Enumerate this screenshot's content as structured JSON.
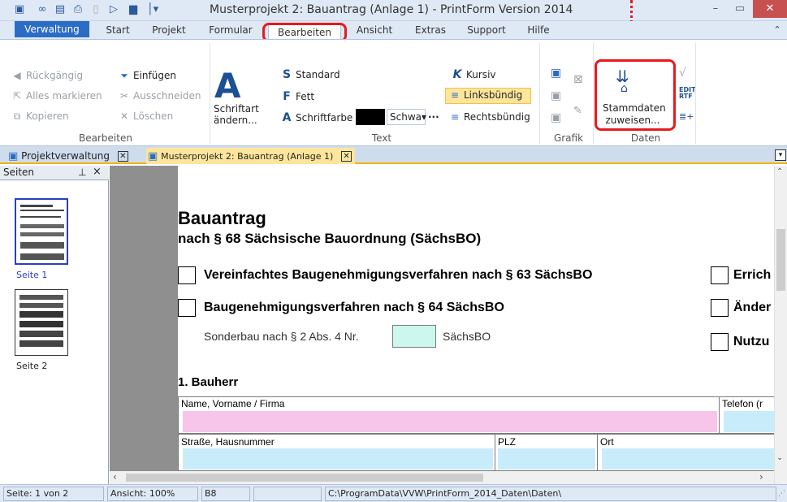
{
  "window": {
    "title": "Musterprojekt 2: Bauantrag (Anlage 1) - PrintForm Version 2014",
    "minimize_icon": "minimize-icon",
    "maximize_icon": "maximize-icon",
    "close_icon": "close-icon"
  },
  "menu_tabs": [
    "Verwaltung",
    "Start",
    "Projekt",
    "Formular",
    "Bearbeiten",
    "Ansicht",
    "Extras",
    "Support",
    "Hilfe"
  ],
  "ribbon": {
    "bearbeiten": {
      "label": "Bearbeiten",
      "undo": "Rückgängig",
      "select_all": "Alles markieren",
      "copy": "Kopieren",
      "paste": "Einfügen",
      "cut": "Ausschneiden",
      "delete": "Löschen"
    },
    "text": {
      "label": "Text",
      "font_change_line1": "Schriftart",
      "font_change_line2": "ändern...",
      "standard": "Standard",
      "bold": "Fett",
      "font_color": "Schriftfarbe",
      "color_value": "Schwa▾",
      "more": "...",
      "italic": "Kursiv",
      "align_left": "Linksbündig",
      "align_right": "Rechtsbündig"
    },
    "grafik": {
      "label": "Grafik"
    },
    "daten": {
      "label": "Daten",
      "assign_line1": "Stammdaten",
      "assign_line2": "zuweisen..."
    }
  },
  "doc_tabs": [
    "Projektverwaltung",
    "Musterprojekt 2: Bauantrag (Anlage 1)"
  ],
  "pages_panel": {
    "title": "Seiten",
    "pin": "⊥",
    "close": "×",
    "pages": [
      "Seite 1",
      "Seite 2"
    ]
  },
  "document": {
    "title": "Bauantrag",
    "subtitle": "nach § 68 Sächsische Bauordnung (SächsBO)",
    "option1": "Vereinfachtes Baugenehmigungsverfahren nach § 63 SächsBO",
    "option2": "Baugenehmigungsverfahren nach § 64 SächsBO",
    "sonderbau": "Sonderbau nach § 2 Abs. 4 Nr.",
    "saechsbo": "SächsBO",
    "right_opt1": "Errich",
    "right_opt2": "Änder",
    "right_opt3": "Nutzu",
    "section1": "1. Bauherr",
    "field_name": "Name, Vorname / Firma",
    "field_phone": "Telefon (r",
    "field_street": "Straße, Hausnummer",
    "field_plz": "PLZ",
    "field_ort": "Ort"
  },
  "status": {
    "page": "Seite: 1 von 2",
    "zoom": "Ansicht: 100%",
    "cell": "B8",
    "path": "C:\\ProgramData\\VVW\\PrintForm_2014_Daten\\Daten\\"
  }
}
